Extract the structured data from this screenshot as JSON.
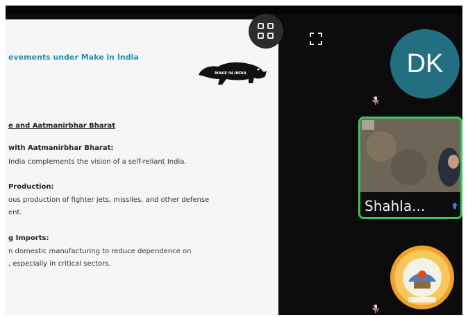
{
  "slide": {
    "title": "evements under Make in India",
    "logo_text": "MAKE IN INDIA",
    "section_heading": "e and Aatmanirbhar Bharat",
    "points": [
      {
        "heading": "with Aatmanirbhar Bharat:",
        "lines": [
          "India complements the vision of a self-reliant India."
        ]
      },
      {
        "heading": "Production:",
        "lines": [
          "ous production of fighter jets, missiles, and other defense",
          "ent."
        ]
      },
      {
        "heading": "g Imports:",
        "lines": [
          "n domestic manufacturing to reduce dependence on",
          ", especially in critical sectors."
        ]
      }
    ]
  },
  "controls": {
    "layout_icon": "grid-layout-icon",
    "fullscreen_icon": "fullscreen-icon"
  },
  "participants": {
    "dk": {
      "initials": "DK",
      "avatar_color": "#236f82",
      "mic_icon": "mic-muted-icon"
    },
    "shahla": {
      "name": "Shahla...",
      "speaking_border": "#36c65a",
      "pin_icon": "pin-icon"
    },
    "org": {
      "emblem_icon": "college-emblem-icon",
      "mic_icon": "mic-muted-icon"
    }
  }
}
